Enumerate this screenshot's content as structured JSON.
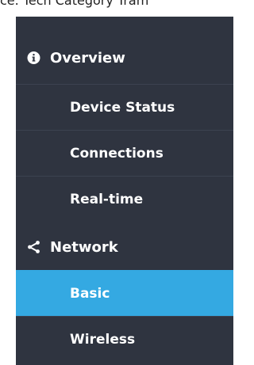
{
  "top_text": "ce. Tech Category Tram",
  "sidebar": {
    "groups": [
      {
        "icon": "info-circle-icon",
        "label": "Overview",
        "items": [
          {
            "label": "Device Status",
            "active": false
          },
          {
            "label": "Connections",
            "active": false
          },
          {
            "label": "Real-time",
            "active": false
          }
        ]
      },
      {
        "icon": "share-icon",
        "label": "Network",
        "items": [
          {
            "label": "Basic",
            "active": true
          },
          {
            "label": "Wireless",
            "active": false
          }
        ]
      }
    ]
  },
  "colors": {
    "sidebar_bg": "#2f3440",
    "active_bg": "#34a9e2",
    "text": "#ffffff"
  }
}
